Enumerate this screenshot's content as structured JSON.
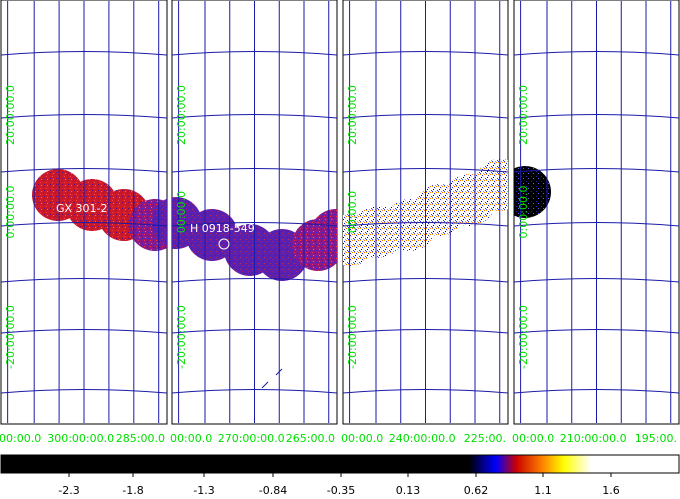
{
  "viewer": {
    "source_labels": [
      {
        "id": "gx",
        "text": "GX 301-2"
      },
      {
        "id": "h0918",
        "text": "H 0918-549"
      }
    ],
    "lon_labels": [
      "00:00.0",
      "300:00:00.0",
      "285:00.0",
      "00:00.0",
      "270:00:00.0",
      "265:00.0",
      "00:00.0",
      "240:00:00.0",
      "225:00.",
      "00:00.0",
      "210:00:00.0",
      "195:00."
    ],
    "lat_labels": [
      "20:00:00.0",
      "0:00:00.0",
      "-20:00:00.0",
      "20:00:00.0",
      "00:00.0",
      "-20:00:00.0",
      "20:00:00.0",
      "00:00.0",
      "-20:00:00.0",
      "20:00:00.0",
      "0:00:00.0",
      "-20:00:00.0"
    ],
    "colorbar": {
      "ticks": [
        "-2.3",
        "-1.8",
        "-1.3",
        "-0.84",
        "-0.35",
        "0.13",
        "0.62",
        "1.1",
        "1.6"
      ],
      "colors": [
        "#000000",
        "#0000ff",
        "#cc0000",
        "#ff8800",
        "#ffff00",
        "#ffffff"
      ]
    },
    "colors": {
      "grid": "#1a1aa8",
      "coord_label": "#00e000",
      "border": "#000000"
    }
  }
}
